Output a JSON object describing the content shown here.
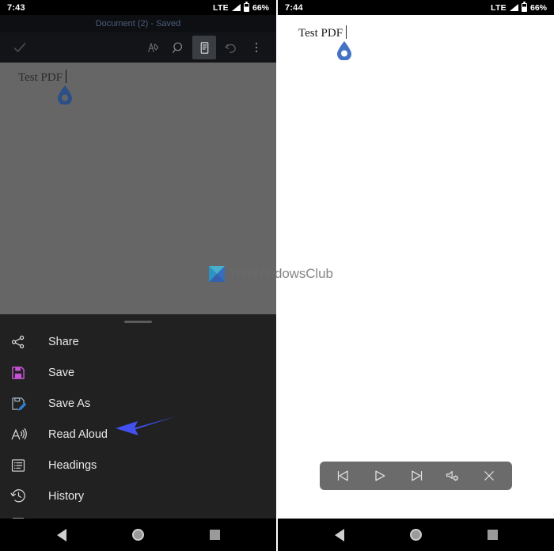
{
  "left_phone": {
    "status_bar": {
      "clock": "7:43",
      "network": "LTE",
      "battery_percent": "66%",
      "signal_icon": "signal-triangle-icon",
      "battery_icon": "battery-icon"
    },
    "title_bar": {
      "document_title": "Document (2) - Saved"
    },
    "toolbar": {
      "done_icon": "check-icon",
      "buttons": [
        {
          "name": "ink-icon",
          "label": "Ink"
        },
        {
          "name": "search-icon",
          "label": "Search"
        },
        {
          "name": "mobile-view-icon",
          "label": "Mobile View"
        },
        {
          "name": "undo-icon",
          "label": "Undo"
        },
        {
          "name": "overflow-menu-icon",
          "label": "More options"
        }
      ]
    },
    "document": {
      "text": "Test PDF",
      "caret_handle_icon": "text-cursor-droplet-icon"
    },
    "bottom_sheet": {
      "drag_handle": "sheet-drag-handle",
      "items": [
        {
          "label": "Share",
          "icon": "share-icon"
        },
        {
          "label": "Save",
          "icon": "save-floppy-icon"
        },
        {
          "label": "Save As",
          "icon": "save-as-icon"
        },
        {
          "label": "Read Aloud",
          "icon": "read-aloud-icon"
        },
        {
          "label": "Headings",
          "icon": "headings-list-icon"
        },
        {
          "label": "History",
          "icon": "history-clock-icon"
        }
      ]
    },
    "annotation": {
      "arrow_icon": "pointer-arrow-icon",
      "color": "#4250ef",
      "points_to": "Read Aloud"
    },
    "nav_bar": {
      "back_icon": "nav-back-icon",
      "home_icon": "nav-home-icon",
      "recents_icon": "nav-recents-icon"
    }
  },
  "right_phone": {
    "status_bar": {
      "clock": "7:44",
      "network": "LTE",
      "battery_percent": "66%",
      "signal_icon": "signal-triangle-icon",
      "battery_icon": "battery-icon"
    },
    "document": {
      "text": "Test PDF",
      "caret_handle_icon": "text-cursor-droplet-icon"
    },
    "read_aloud_toolbar": {
      "buttons": [
        {
          "name": "previous-button",
          "label": "Previous",
          "icon": "skip-previous-icon"
        },
        {
          "name": "play-button",
          "label": "Play",
          "icon": "play-icon"
        },
        {
          "name": "next-button",
          "label": "Next",
          "icon": "skip-next-icon"
        },
        {
          "name": "audio-settings-button",
          "label": "Audio Settings",
          "icon": "speaker-gear-icon"
        },
        {
          "name": "close-button",
          "label": "Close",
          "icon": "close-x-icon"
        }
      ]
    },
    "nav_bar": {
      "back_icon": "nav-back-icon",
      "home_icon": "nav-home-icon",
      "recents_icon": "nav-recents-icon"
    }
  },
  "watermark": {
    "text": "TheWindowsClub",
    "logo_icon": "thewindowsclub-logo-icon"
  },
  "colors": {
    "accent_arrow": "#4250ef",
    "save_icon": "#c552d2",
    "save_as_icon": "#2d7fd3",
    "droplet": "#4472c4",
    "sheet_bg": "#212121",
    "dim_overlay": "#666666",
    "toolbar_bg": "#6b6b6b"
  }
}
